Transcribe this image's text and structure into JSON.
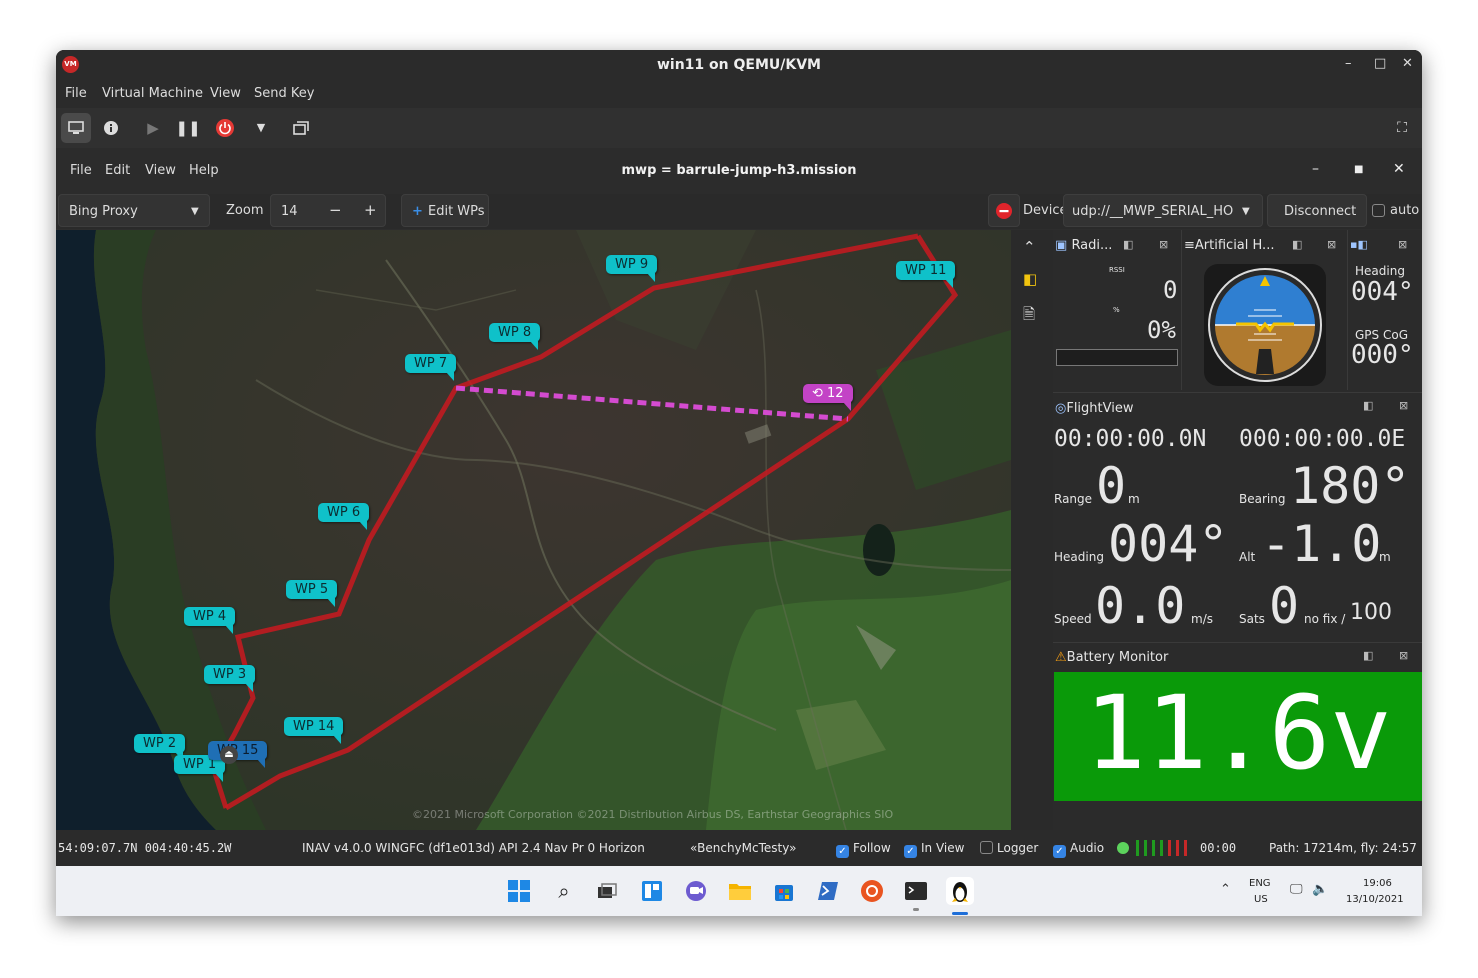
{
  "host": {
    "window_title": "win11 on QEMU/KVM",
    "menu": [
      "File",
      "Virtual Machine",
      "View",
      "Send Key"
    ]
  },
  "app": {
    "title": "mwp = barrule-jump-h3.mission",
    "menu": [
      "File",
      "Edit",
      "View",
      "Help"
    ],
    "toolbar": {
      "map_source": "Bing Proxy",
      "zoom_label": "Zoom",
      "zoom_value": "14",
      "zoom_minus": "−",
      "zoom_plus": "+",
      "edit_wps": "Edit WPs",
      "device_label": "Device",
      "device_value": "udp://__MWP_SERIAL_HO",
      "disconnect": "Disconnect",
      "auto": "auto"
    },
    "map": {
      "waypoints": [
        "WP 9",
        "WP 11",
        "WP 8",
        "WP 7",
        "WP 6",
        "WP 5",
        "WP 4",
        "WP 3",
        "WP 14",
        "WP 2",
        "WP 1",
        "WP 15"
      ],
      "jump_marker": "⟲ 12",
      "attribution": "©2021 Microsoft Corporation  ©2021 Distribution Airbus DS, Earthstar Geographics SIO"
    },
    "radio": {
      "title": "Radi...",
      "rssi_label": "RSSI",
      "rssi_value": "0",
      "pct_label": "%",
      "pct_value": "0%"
    },
    "horizon": {
      "title": "Artificial H..."
    },
    "heading": {
      "heading_label": "Heading",
      "heading_value": "004°",
      "cog_label": "GPS CoG",
      "cog_value": "000°"
    },
    "flightview": {
      "title": "FlightView",
      "lat": "00:00:00.0N",
      "lon": "000:00:00.0E",
      "range_label": "Range",
      "range_value": "0",
      "range_unit": "m",
      "bearing_label": "Bearing",
      "bearing_value": "180°",
      "heading_label": "Heading",
      "heading_value": "004°",
      "alt_label": "Alt",
      "alt_value": "-1.0",
      "alt_unit": "m",
      "speed_label": "Speed",
      "speed_value": "0.0",
      "speed_unit": "m/s",
      "sats_label": "Sats",
      "sats_value": "0",
      "sats_fix": "no fix /",
      "sats_hdop": "100"
    },
    "battery": {
      "title": "Battery Monitor",
      "voltage": "11.6v",
      "color": "#0a9a09"
    },
    "status": {
      "position": "54:09:07.7N 004:40:45.2W",
      "fc_info": "INAV v4.0.0  WINGFC (df1e013d) API 2.4 Nav Pr 0 Horizon",
      "craft": "«BenchyMcTesty»",
      "follow": "Follow",
      "in_view": "In View",
      "logger": "Logger",
      "audio": "Audio",
      "timer": "00:00",
      "path": "Path: 17214m, fly: 24:57"
    }
  },
  "taskbar": {
    "lang_top": "ENG",
    "lang_bottom": "US",
    "time": "19:06",
    "date": "13/10/2021"
  }
}
